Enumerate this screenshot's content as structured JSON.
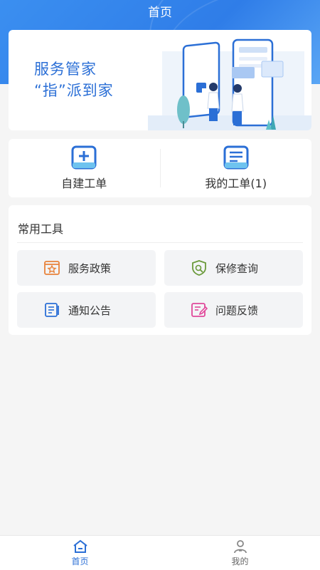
{
  "header": {
    "title": "首页"
  },
  "banner": {
    "line1": "服务管家",
    "line2": "“指”派到家"
  },
  "quick_actions": [
    {
      "label": "自建工单",
      "icon": "add-document-icon"
    },
    {
      "label": "我的工单(1)",
      "icon": "list-document-icon"
    }
  ],
  "tools": {
    "title": "常用工具",
    "items": [
      {
        "label": "服务政策",
        "icon": "policy-star-icon",
        "color": "#e8823a"
      },
      {
        "label": "保修查询",
        "icon": "shield-search-icon",
        "color": "#6a9a3a"
      },
      {
        "label": "通知公告",
        "icon": "notice-list-icon",
        "color": "#2b6fd6"
      },
      {
        "label": "问题反馈",
        "icon": "feedback-edit-icon",
        "color": "#e0489a"
      }
    ]
  },
  "tabbar": {
    "items": [
      {
        "label": "首页",
        "icon": "home-icon",
        "active": true
      },
      {
        "label": "我的",
        "icon": "user-icon",
        "active": false
      }
    ]
  },
  "colors": {
    "primary": "#2b6fd6",
    "header_bg": "#3285ec"
  }
}
